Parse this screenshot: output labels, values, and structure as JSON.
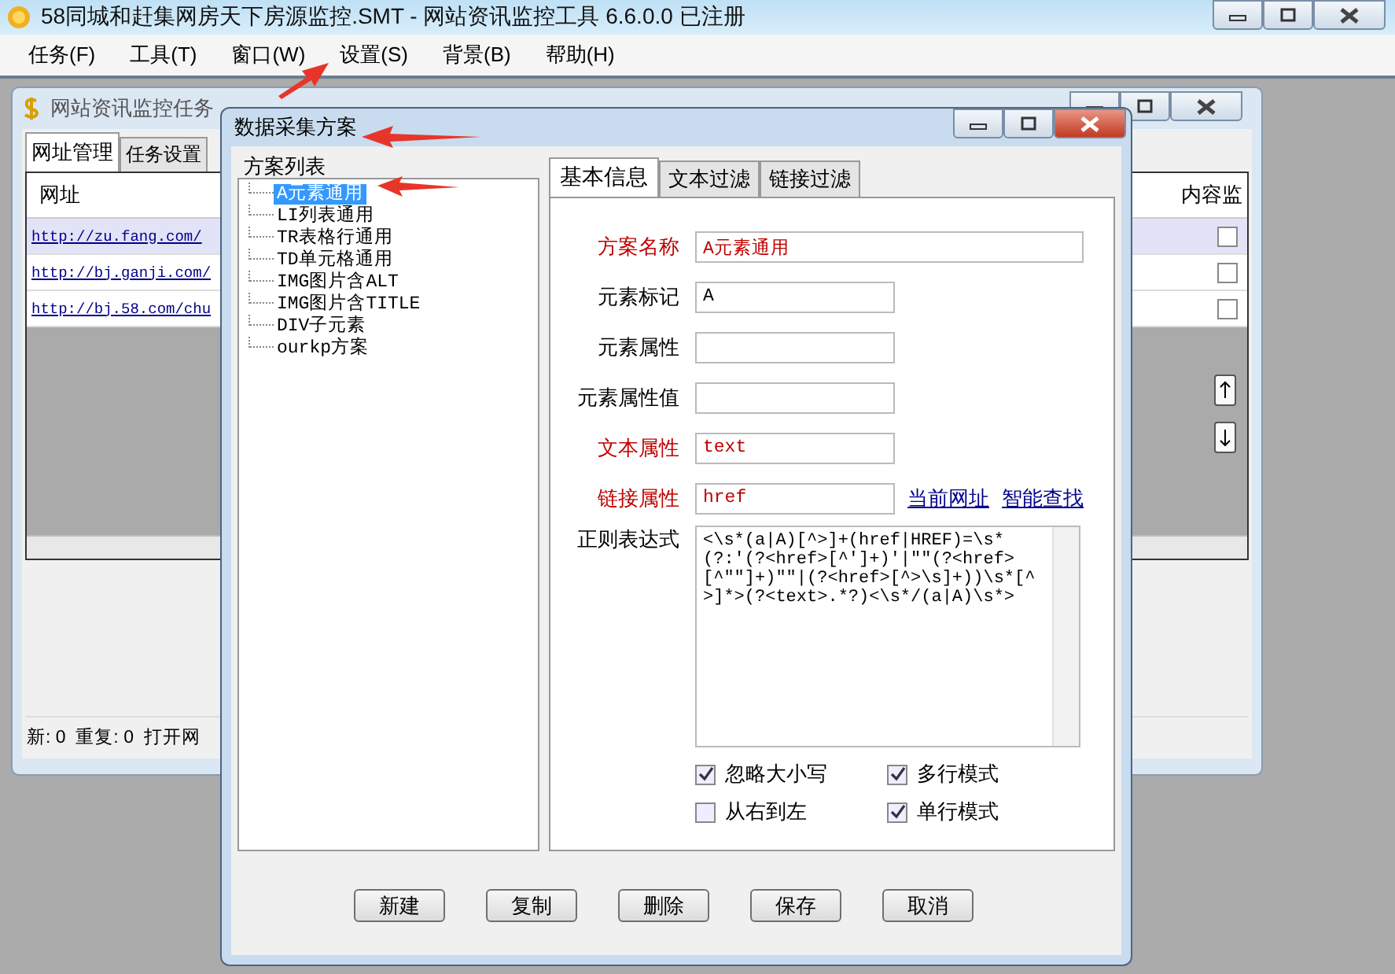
{
  "window": {
    "title": "58同城和赶集网房天下房源监控.SMT  - 网站资讯监控工具 6.6.0.0  已注册"
  },
  "menu": [
    {
      "label": "任务(F)"
    },
    {
      "label": "工具(T)"
    },
    {
      "label": "窗口(W)"
    },
    {
      "label": "设置(S)"
    },
    {
      "label": "背景(B)"
    },
    {
      "label": "帮助(H)"
    }
  ],
  "child_window": {
    "title": "网站资讯监控任务",
    "tabs": [
      {
        "label": "网址管理",
        "selected": true
      },
      {
        "label": "任务设置",
        "selected": false
      }
    ],
    "table": {
      "columns": [
        "网址",
        "内容监"
      ],
      "rows": [
        {
          "url": "http://zu.fang.com/",
          "selected": true,
          "checked": false
        },
        {
          "url": "http://bj.ganji.com/",
          "selected": false,
          "checked": false
        },
        {
          "url": "http://bj.58.com/chu",
          "selected": false,
          "checked": false
        }
      ]
    },
    "status_bar": "新: 0  重复: 0  打开网"
  },
  "dialog": {
    "title": "数据采集方案",
    "scheme_list": {
      "title": "方案列表",
      "items": [
        {
          "label": "A元素通用",
          "selected": true
        },
        {
          "label": "LI列表通用",
          "selected": false
        },
        {
          "label": "TR表格行通用",
          "selected": false
        },
        {
          "label": "TD单元格通用",
          "selected": false
        },
        {
          "label": "IMG图片含ALT",
          "selected": false
        },
        {
          "label": "IMG图片含TITLE",
          "selected": false
        },
        {
          "label": "DIV子元素",
          "selected": false
        },
        {
          "label": "ourkp方案",
          "selected": false
        }
      ]
    },
    "tabs": [
      {
        "label": "基本信息",
        "selected": true
      },
      {
        "label": "文本过滤",
        "selected": false
      },
      {
        "label": "链接过滤",
        "selected": false
      }
    ],
    "fields": [
      {
        "label": "方案名称",
        "value": "A元素通用",
        "required": true,
        "kind": "wide"
      },
      {
        "label": "元素标记",
        "value": "A",
        "required": false,
        "kind": "short"
      },
      {
        "label": "元素属性",
        "required": false,
        "kind": "short"
      },
      {
        "label": "元素属性值",
        "required": false,
        "kind": "short"
      },
      {
        "label": "文本属性",
        "value": "text",
        "required": true,
        "kind": "short"
      },
      {
        "label": "链接属性",
        "value": "href",
        "required": true,
        "kind": "short"
      }
    ],
    "field_links": [
      "当前网址",
      "智能查找"
    ],
    "regex": {
      "label": "正则表达式",
      "value": "<\\s*(a|A)[^>]+(href|HREF)=\\s*(?:'(?<href>[^']+)'|\"\"(?<href>[^\"\"]+)\"\"|(?<href>[^>\\s]+))\\s*[^>]*>(?<text>.*?)<\\s*/(a|A)\\s*>"
    },
    "options": [
      {
        "label": "忽略大小写",
        "checked": true
      },
      {
        "label": "多行模式",
        "checked": true
      },
      {
        "label": "从右到左",
        "checked": false
      },
      {
        "label": "单行模式",
        "checked": true
      }
    ],
    "buttons": [
      "新建",
      "复制",
      "删除",
      "保存",
      "取消"
    ]
  }
}
